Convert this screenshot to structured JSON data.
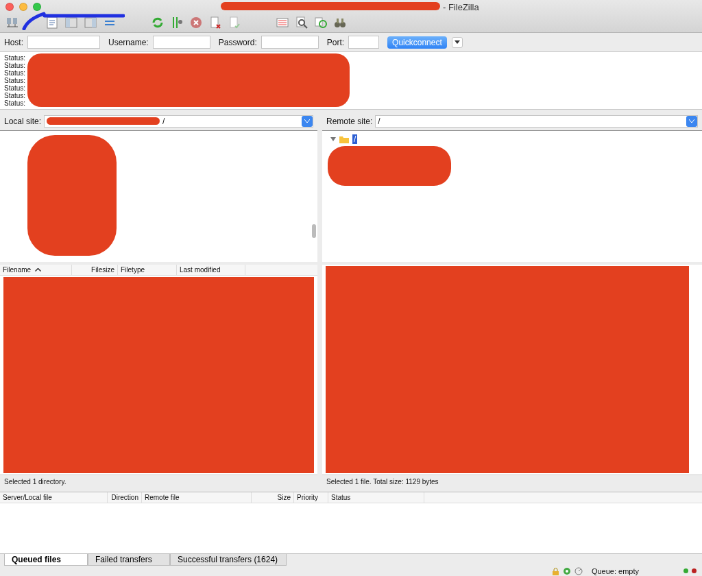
{
  "window": {
    "title": "- FileZilla"
  },
  "quickconnect": {
    "fields": [
      {
        "label": "Host:"
      },
      {
        "label": "Username:"
      },
      {
        "label": "Password:"
      },
      {
        "label": "Port:"
      }
    ],
    "button": "Quickconnect"
  },
  "message_log": {
    "lines": [
      "Status:",
      "Status:",
      "Status:",
      "Status:",
      "Status:",
      "Status:",
      "Status:"
    ]
  },
  "local_site": {
    "label": "Local site:",
    "path": "/"
  },
  "remote_site": {
    "label": "Remote site:",
    "path": "/",
    "tree": [
      {
        "label": "/",
        "selected": true,
        "expanded": true
      }
    ]
  },
  "local_files": {
    "columns": [
      {
        "label": "Filename",
        "sorted": true
      },
      {
        "label": "Filesize",
        "sorted": false
      },
      {
        "label": "Filetype",
        "sorted": false
      },
      {
        "label": "Last modified",
        "sorted": false
      }
    ],
    "status": "Selected 1 directory."
  },
  "remote_files": {
    "status": "Selected 1 file. Total size: 1129 bytes"
  },
  "queue": {
    "columns": [
      "Server/Local file",
      "Direction",
      "Remote file",
      "Size",
      "Priority",
      "Status"
    ]
  },
  "queue_tabs": [
    {
      "label": "Queued files",
      "selected": true
    },
    {
      "label": "Failed transfers",
      "selected": false
    },
    {
      "label": "Successful transfers (1624)",
      "selected": false
    }
  ],
  "status_bar": {
    "queue": "Queue: empty"
  }
}
